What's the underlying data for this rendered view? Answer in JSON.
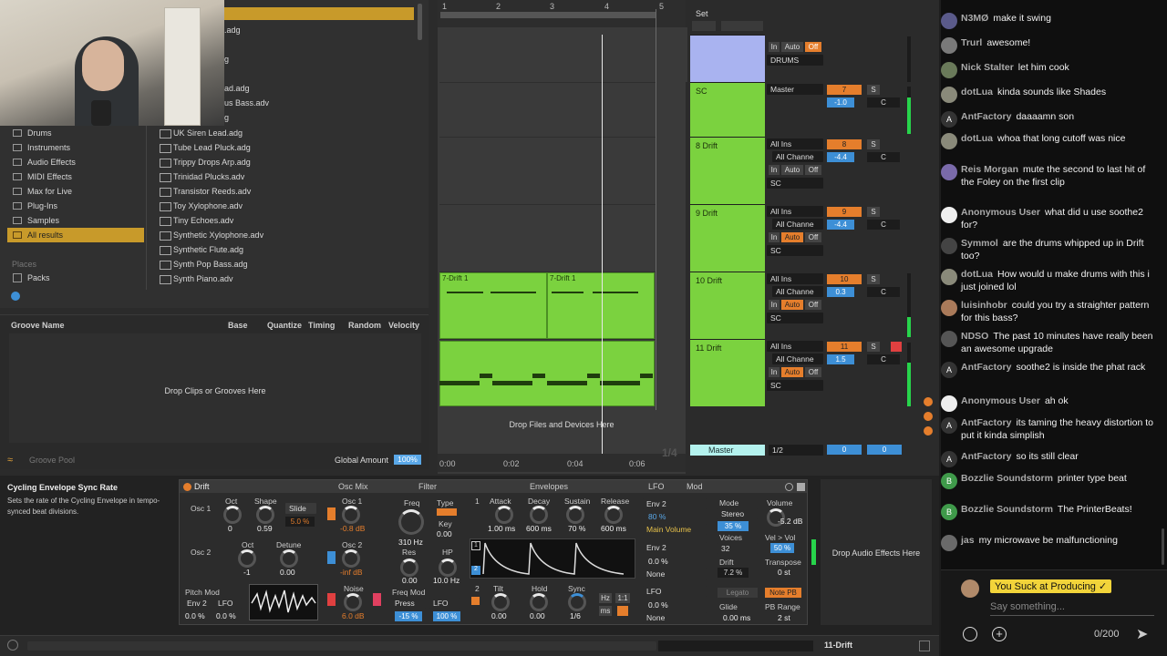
{
  "browser": {
    "categories": [
      "Drums",
      "Instruments",
      "Audio Effects",
      "MIDI Effects",
      "Max for Live",
      "Plug-Ins",
      "Samples",
      "All results"
    ],
    "places_label": "Places",
    "packs_label": "Packs",
    "upper_files": [
      ".adg",
      "g",
      "ad.adg",
      "us Bass.adv",
      "g"
    ],
    "files": [
      "UK Siren Lead.adg",
      "Tube Lead Pluck.adg",
      "Trippy Drops Arp.adg",
      "Trinidad Plucks.adv",
      "Transistor Reeds.adv",
      "Toy Xylophone.adv",
      "Tiny Echoes.adv",
      "Synthetic Xylophone.adv",
      "Synthetic Flute.adg",
      "Synth Pop Bass.adg",
      "Synth Piano.adv"
    ]
  },
  "groove": {
    "headers": [
      "Groove Name",
      "Base",
      "Quantize",
      "Timing",
      "Random",
      "Velocity"
    ],
    "drop_text": "Drop Clips or Grooves Here",
    "pool_label": "Groove Pool",
    "global_amount_label": "Global Amount",
    "global_amount": "100%"
  },
  "arrangement": {
    "bar_ticks": [
      "1",
      "2",
      "3",
      "4",
      "5"
    ],
    "set_label": "Set",
    "clip_names": [
      "7-Drift 1",
      "7-Drift 1"
    ],
    "drop_text": "Drop Files and Devices Here",
    "time_ticks": [
      "0:00",
      "0:02",
      "0:04",
      "0:06"
    ],
    "time_fraction": "1/4"
  },
  "mixer": {
    "tracks": [
      {
        "name": "",
        "input": "",
        "channel": "DRUMS",
        "monitor": [
          "In",
          "Auto",
          "Off"
        ],
        "num": "",
        "vol": ""
      },
      {
        "name": "SC",
        "input": "Master",
        "channel": "",
        "monitor": [],
        "num": "7",
        "vol": "-1.0"
      },
      {
        "name": "8 Drift",
        "input": "All Ins",
        "channel": "All Channe",
        "monitor": [
          "In",
          "Auto",
          "Off"
        ],
        "sc": "SC",
        "num": "8",
        "vol": "-4.4"
      },
      {
        "name": "9 Drift",
        "input": "All Ins",
        "channel": "All Channe",
        "monitor": [
          "In",
          "Auto",
          "Off"
        ],
        "sc": "SC",
        "num": "9",
        "vol": "-4.4"
      },
      {
        "name": "10 Drift",
        "input": "All Ins",
        "channel": "All Channe",
        "monitor": [
          "In",
          "Auto",
          "Off"
        ],
        "sc": "SC",
        "num": "10",
        "vol": "0.3"
      },
      {
        "name": "11 Drift",
        "input": "All Ins",
        "channel": "All Channe",
        "monitor": [
          "In",
          "Auto",
          "Off"
        ],
        "sc": "SC",
        "num": "11",
        "vol": "1.5"
      }
    ],
    "solo": "S",
    "center": "C",
    "master_label": "Master",
    "master_routing": "1/2",
    "master_vol": "0",
    "master_pan": "0"
  },
  "device": {
    "info_title": "Cycling Envelope Sync Rate",
    "info_text": "Sets the rate of the Cycling Envelope in tempo-synced beat divisions.",
    "name": "Drift",
    "sections": [
      "Osc Mix",
      "Filter",
      "Envelopes",
      "LFO",
      "Mod"
    ],
    "osc1": {
      "label": "Osc 1",
      "oct_label": "Oct",
      "oct": "0",
      "shape_label": "Shape",
      "shape": "0.59",
      "mode": "Slide",
      "mode_val": "5.0 %",
      "mix_label": "Osc 1",
      "mix": "-0.8 dB"
    },
    "osc2": {
      "label": "Osc 2",
      "oct_label": "Oct",
      "oct": "-1",
      "detune_label": "Detune",
      "detune": "0.00",
      "mix_label": "Osc 2",
      "mix": "-inf dB"
    },
    "pitch_mod": {
      "label": "Pitch Mod",
      "src1": "Env 2",
      "src2": "LFO",
      "amt1": "0.0 %",
      "amt2": "0.0 %"
    },
    "noise": {
      "label": "Noise",
      "val": "6.0 dB"
    },
    "filter": {
      "freq_label": "Freq",
      "freq": "310 Hz",
      "type_label": "Type",
      "key_label": "Key",
      "key": "0.00",
      "res_label": "Res",
      "res": "0.00",
      "hp_label": "HP",
      "hp": "10.0 Hz",
      "freqmod_label": "Freq Mod",
      "fm_src1": "Press",
      "fm_src2": "LFO",
      "fm_amt1": "-15 %",
      "fm_amt2": "100 %"
    },
    "env1": {
      "num": "1",
      "attack_label": "Attack",
      "attack": "1.00 ms",
      "decay_label": "Decay",
      "decay": "600 ms",
      "sustain_label": "Sustain",
      "sustain": "70 %",
      "release_label": "Release",
      "release": "600 ms"
    },
    "env2": {
      "num": "2",
      "tilt_label": "Tilt",
      "tilt": "0.00",
      "hold_label": "Hold",
      "hold": "0.00",
      "sync_label": "Sync",
      "sync": "1/6",
      "hz": "Hz",
      "ratio": "1:1",
      "ms": "ms"
    },
    "mod": {
      "src1": "Env 2",
      "amt1": "80 %",
      "dst1": "Main Volume",
      "src2": "Env 2",
      "amt2": "0.0 %",
      "dst2": "None",
      "src3": "LFO",
      "amt3": "0.0 %",
      "dst3": "None"
    },
    "voice": {
      "mode_label": "Mode",
      "mode": "Stereo",
      "mode_val": "35 %",
      "voices_label": "Voices",
      "voices": "32",
      "drift_label": "Drift",
      "drift": "7.2 %",
      "legato": "Legato",
      "glide_label": "Glide",
      "glide": "0.00 ms",
      "volume_label": "Volume",
      "volume": "-5.2 dB",
      "velvol_label": "Vel > Vol",
      "velvol": "50 %",
      "transpose_label": "Transpose",
      "transpose": "0 st",
      "notepb": "Note PB",
      "pbrange_label": "PB Range",
      "pbrange": "2 st"
    },
    "drop_text": "Drop Audio Effects Here"
  },
  "status": {
    "track": "11-Drift"
  },
  "chat": {
    "messages": [
      {
        "user": "N3MØ",
        "text": "make it swing"
      },
      {
        "user": "Trurl",
        "text": "awesome!"
      },
      {
        "user": "Nick Stalter",
        "text": "let him cook"
      },
      {
        "user": "dotLua",
        "text": "kinda sounds like Shades"
      },
      {
        "user": "AntFactory",
        "text": "daaaamn son"
      },
      {
        "user": "dotLua",
        "text": "whoa that long cutoff was nice"
      },
      {
        "user": "Reis Morgan",
        "text": "mute the second to last hit of the Foley on the first clip"
      },
      {
        "user": "Anonymous User",
        "text": "what did u use soothe2 for?"
      },
      {
        "user": "Symmol",
        "text": "are the drums whipped up in Drift too?"
      },
      {
        "user": "dotLua",
        "text": "How would u make drums with this i just joined lol"
      },
      {
        "user": "luisinhobr",
        "text": "could you try a straighter pattern for this bass?"
      },
      {
        "user": "NDSO",
        "text": "The past 10 minutes have really been an awesome upgrade"
      },
      {
        "user": "AntFactory",
        "text": "soothe2 is inside the phat rack"
      },
      {
        "user": "Anonymous User",
        "text": "ah ok"
      },
      {
        "user": "AntFactory",
        "text": "its taming the heavy distortion to put it kinda simplish"
      },
      {
        "user": "AntFactory",
        "text": "so its still clear"
      },
      {
        "user": "Bozzlie Soundstorm",
        "text": "printer type beat"
      },
      {
        "user": "Bozzlie Soundstorm",
        "text": "The PrinterBeats!"
      },
      {
        "user": "jas",
        "text": "my microwave be malfunctioning"
      }
    ],
    "pinned": "You Suck at Producing ✓",
    "placeholder": "Say something...",
    "counter": "0/200"
  }
}
